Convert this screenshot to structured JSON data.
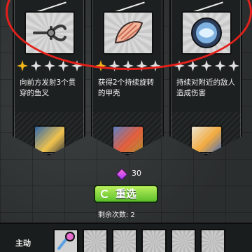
{
  "cards": [
    {
      "icon": "anchor-icon",
      "stars_filled": 1,
      "stars_total": 5,
      "description": "向前方发射3个贯穿的鱼叉",
      "hero": "character-portrait-1"
    },
    {
      "icon": "seashell-icon",
      "stars_filled": 1,
      "stars_total": 5,
      "description": "获得2个持续旋转的甲壳",
      "hero": "character-portrait-2"
    },
    {
      "icon": "water-orb-icon",
      "stars_filled": 0,
      "stars_total": 5,
      "description": "持续对附近的敌人造成伤害",
      "hero": "character-portrait-3"
    }
  ],
  "gems": "30",
  "reroll_label": "重选",
  "remaining_label": "剩余次数: 2",
  "skill_bar_label": "主动",
  "colors": {
    "highlight_circle": "#e3201b",
    "reroll_button": "#6cc92f",
    "star_filled": "#f1b51c"
  }
}
